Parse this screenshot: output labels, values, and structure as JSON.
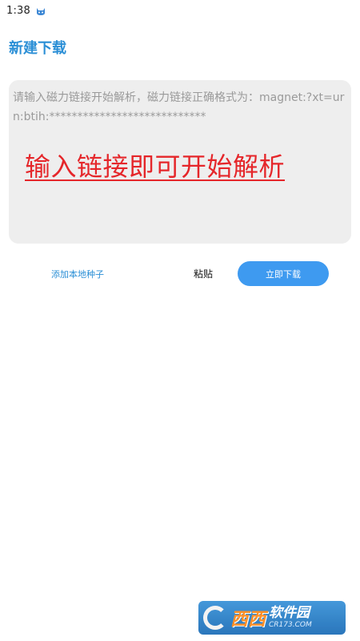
{
  "status_bar": {
    "time": "1:38",
    "notification_icon": "cat-icon"
  },
  "header": {
    "title": "新建下载"
  },
  "input": {
    "placeholder": "请输入磁力链接开始解析，磁力链接正确格式为：magnet:?xt=urn:btih:****************************",
    "annotation": "输入链接即可开始解析"
  },
  "actions": {
    "add_local_seed": "添加本地种子",
    "paste": "粘贴",
    "download_now": "立即下载"
  },
  "watermark": {
    "brand": "西西",
    "name": "软件园",
    "url": "CR173.COM"
  },
  "colors": {
    "accent": "#2b8fd6",
    "button": "#3e9af0",
    "annotation": "#e5262a",
    "card_bg": "#eeeeee"
  }
}
